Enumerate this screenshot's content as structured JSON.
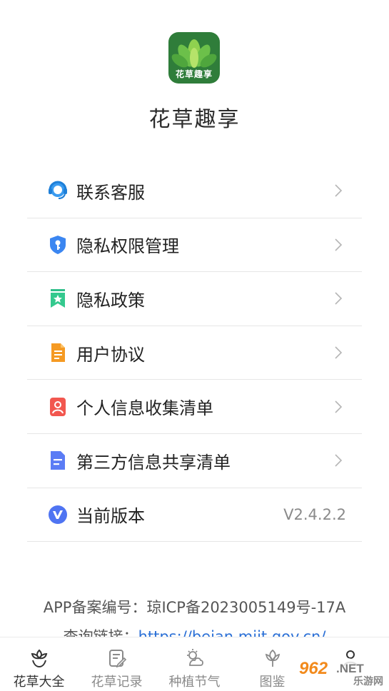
{
  "app": {
    "name": "花草趣享",
    "logo_text": "花草趣享"
  },
  "menu": {
    "items": [
      {
        "label": "联系客服",
        "icon": "customer-service-icon"
      },
      {
        "label": "隐私权限管理",
        "icon": "shield-key-icon"
      },
      {
        "label": "隐私政策",
        "icon": "bookmark-star-icon"
      },
      {
        "label": "用户协议",
        "icon": "document-icon"
      },
      {
        "label": "个人信息收集清单",
        "icon": "person-card-icon"
      },
      {
        "label": "第三方信息共享清单",
        "icon": "list-document-icon"
      },
      {
        "label": "当前版本",
        "icon": "version-v-icon",
        "value": "V2.4.2.2"
      }
    ]
  },
  "footer": {
    "record_label": "APP备案编号：琼ICP备2023005149号-17A",
    "query_label": "查询链接：",
    "query_link": "https://beian.miit.gov.cn/"
  },
  "tabbar": {
    "tabs": [
      {
        "label": "花草大全",
        "icon": "flower-icon",
        "active": true
      },
      {
        "label": "花草记录",
        "icon": "note-edit-icon",
        "active": false
      },
      {
        "label": "种植节气",
        "icon": "weather-cloud-icon",
        "active": false
      },
      {
        "label": "图鉴",
        "icon": "gallery-icon",
        "active": false
      },
      {
        "label": "",
        "icon": "user-icon",
        "active": false
      }
    ]
  },
  "watermark": {
    "text": "962.NET",
    "subtext": "乐游网"
  },
  "colors": {
    "logo_bg": "#2f7d3a",
    "link": "#2a6fd6",
    "divider": "#e6e6e6",
    "muted_text": "#8a8a8a"
  }
}
